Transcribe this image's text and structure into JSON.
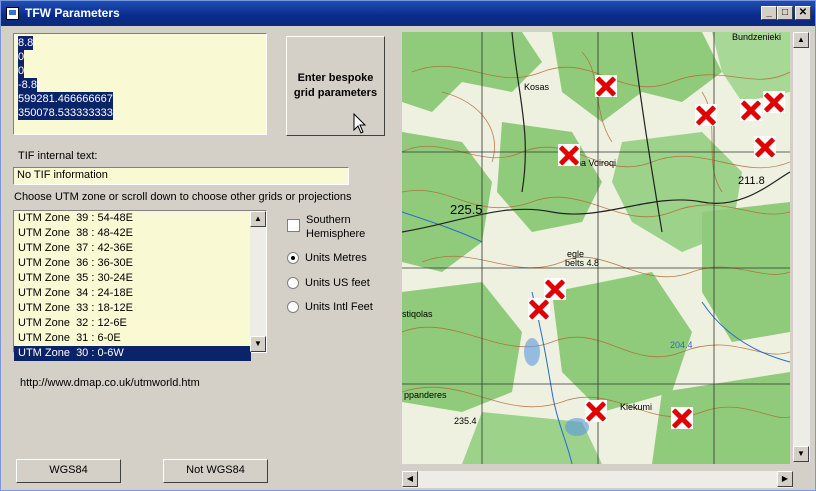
{
  "window": {
    "title": "TFW Parameters"
  },
  "tfw_values": [
    "8.8",
    "0",
    "0",
    "-8.8",
    "599281.466666667",
    "350078.533333333"
  ],
  "bespoke_button": "Enter bespoke grid parameters",
  "tif_label": "TIF internal text:",
  "tif_value": "No TIF information",
  "zone_prompt": "Choose UTM zone or scroll down to choose other grids or projections",
  "utm_zones": [
    "UTM Zone  39 : 54-48E",
    "UTM Zone  38 : 48-42E",
    "UTM Zone  37 : 42-36E",
    "UTM Zone  36 : 36-30E",
    "UTM Zone  35 : 30-24E",
    "UTM Zone  34 : 24-18E",
    "UTM Zone  33 : 18-12E",
    "UTM Zone  32 : 12-6E",
    "UTM Zone  31 : 6-0E",
    "UTM Zone  30 : 0-6W"
  ],
  "selected_zone": "UTM Zone  30 : 0-6W",
  "hemisphere_label": "Southern Hemisphere",
  "units": [
    {
      "label": "Units Metres",
      "checked": true
    },
    {
      "label": "Units US feet",
      "checked": false
    },
    {
      "label": "Units Intl Feet",
      "checked": false
    }
  ],
  "url": "http://www.dmap.co.uk/utmworld.htm",
  "buttons": {
    "wgs84": "WGS84",
    "not_wgs84": "Not WGS84"
  },
  "map_labels": [
    "Kosas",
    "lna Voiroqi",
    "211.8",
    "225.5",
    "egle",
    "belts 4.8",
    "stiqolas",
    "ppanderes",
    "235.4",
    "Kiekumi",
    "Bundzenieki",
    "204.4"
  ],
  "colors": {
    "selection": "#0a246a",
    "field_bg": "#f9f9d4",
    "marker": "#e00000",
    "forest": "#7fbf6a"
  }
}
